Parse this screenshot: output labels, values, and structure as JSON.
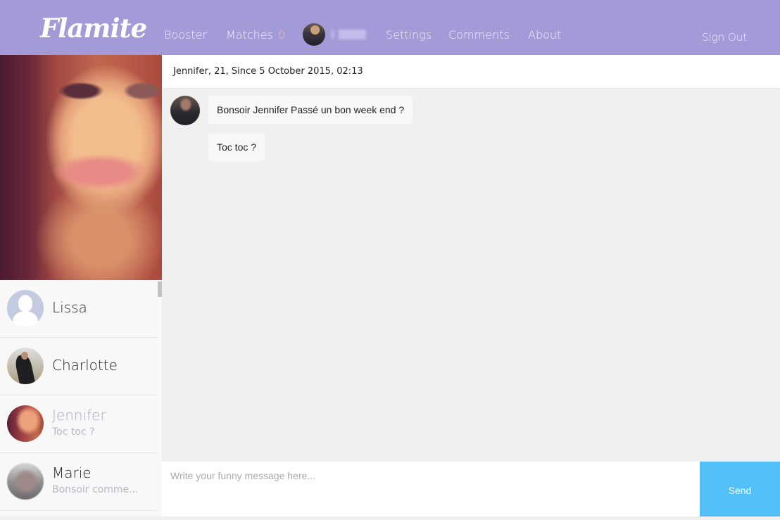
{
  "app": {
    "brand": "Flamite",
    "colors": {
      "nav_bg": "#a29bd7",
      "send_button": "#53c1f8",
      "chat_bg": "#f0f0f0",
      "match_count": "#f4b9c2"
    }
  },
  "nav": {
    "booster": "Booster",
    "matches": {
      "label": "Matches",
      "count": "0"
    },
    "user": {
      "avatar": "user-avatar",
      "name": "████"
    },
    "settings": "Settings",
    "comments": "Comments",
    "about": "About",
    "sign_out": "Sign Out"
  },
  "profile": {
    "photo": "profile-photo-jennifer"
  },
  "contacts": [
    {
      "name": "Lissa",
      "preview": "",
      "avatar": "default-avatar",
      "active": false
    },
    {
      "name": "Charlotte",
      "preview": "",
      "avatar": "photo-avatar",
      "active": false
    },
    {
      "name": "Jennifer",
      "preview": "Toc toc ?",
      "avatar": "photo-avatar",
      "active": true
    },
    {
      "name": "Marie",
      "preview": "Bonsoir comme...",
      "avatar": "photo-avatar",
      "active": false
    }
  ],
  "chat": {
    "header": "Jennifer, 21, Since 5 October 2015, 02:13",
    "messages": [
      {
        "text": "Bonsoir Jennifer Passé un bon week end ?",
        "from": "me"
      },
      {
        "text": "Toc toc ?",
        "from": "me"
      }
    ]
  },
  "composer": {
    "placeholder": "Write your funny message here...",
    "value": "",
    "send_label": "Send"
  }
}
